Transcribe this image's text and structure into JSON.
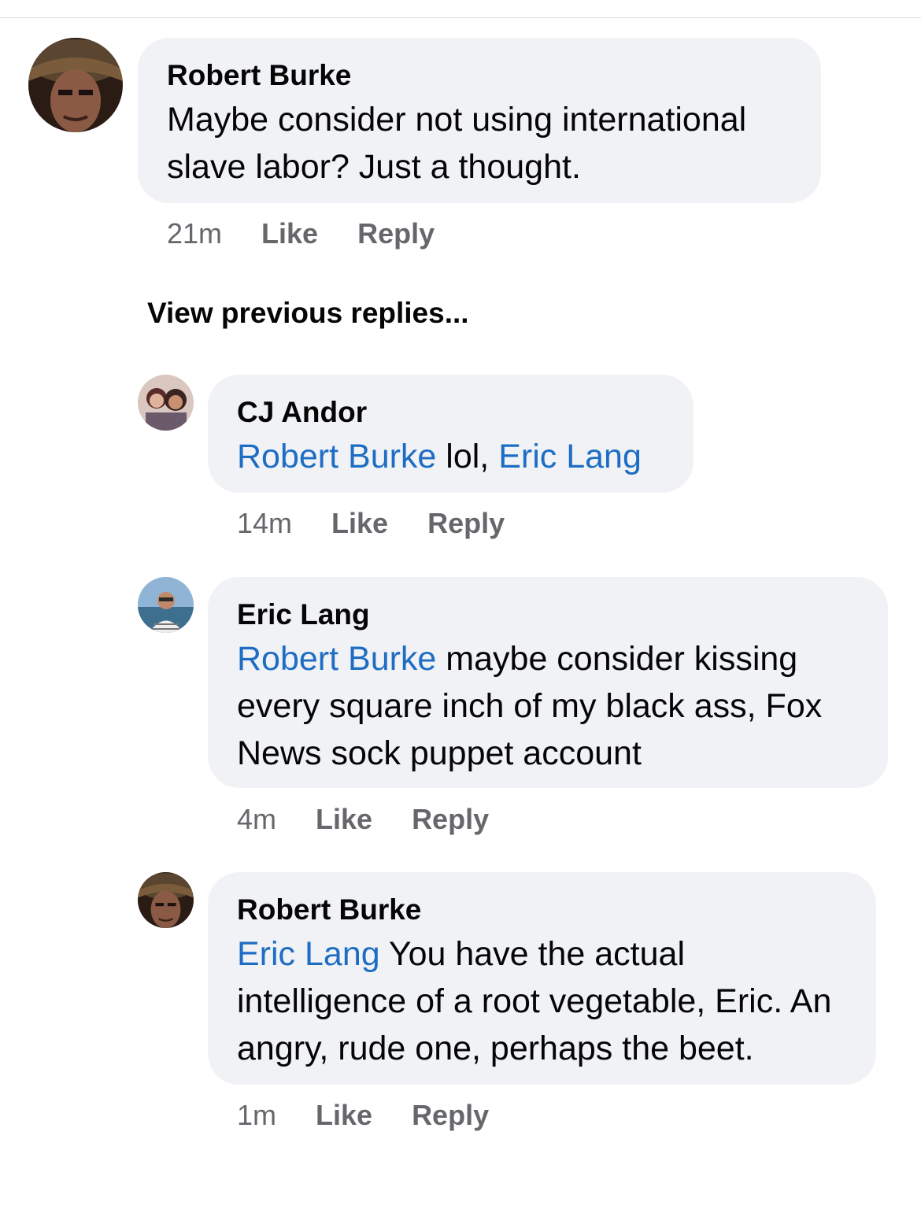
{
  "comments": [
    {
      "author": "Robert Burke",
      "mention": "",
      "text": "Maybe consider not using international slave labor? Just a thought.",
      "time": "21m",
      "like_label": "Like",
      "reply_label": "Reply"
    },
    {
      "author": "CJ Andor",
      "mention": "Robert Burke",
      "text_mid": " lol, ",
      "mention2": "Eric Lang",
      "time": "14m",
      "like_label": "Like",
      "reply_label": "Reply"
    },
    {
      "author": "Eric Lang",
      "mention": "Robert Burke",
      "text": " maybe consider kissing every square inch of my black ass, Fox News sock puppet account",
      "time": "4m",
      "like_label": "Like",
      "reply_label": "Reply"
    },
    {
      "author": "Robert Burke",
      "mention": "Eric Lang",
      "text": " You have the actual intelligence of a root vegetable, Eric. An angry, rude one, perhaps the beet.",
      "time": "1m",
      "like_label": "Like",
      "reply_label": "Reply"
    }
  ],
  "view_previous_replies": "View previous replies...",
  "colors": {
    "bubble": "#f0f2f5",
    "mention": "#1e6dc4",
    "meta": "#65676b"
  }
}
